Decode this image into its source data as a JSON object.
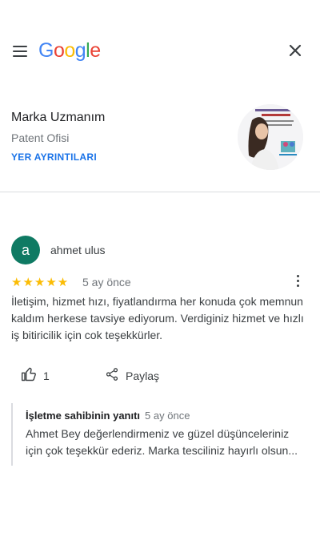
{
  "header": {
    "logo_letters": [
      "G",
      "o",
      "o",
      "g",
      "l",
      "e"
    ],
    "logo_colors": [
      "#4285F4",
      "#EA4335",
      "#FBBC05",
      "#4285F4",
      "#34A853",
      "#EA4335"
    ]
  },
  "business": {
    "name": "Marka Uzmanım",
    "category": "Patent Ofisi",
    "details_link": "YER AYRINTILARI"
  },
  "review": {
    "avatar_letter": "a",
    "author": "ahmet ulus",
    "stars": "★★★★★",
    "rating": 5,
    "time": "5 ay önce",
    "text": "İletişim, hizmet hızı, fiyatlandırma her konuda çok memnun kaldım herkese tavsiye ediyorum. Verdiginiz hizmet ve hızlı iş bitiricilik için cok teşekkürler.",
    "like_count": "1",
    "share_label": "Paylaş"
  },
  "reply": {
    "title": "İşletme sahibinin yanıtı",
    "time": "5 ay önce",
    "text": "Ahmet Bey değerlendirmeniz ve güzel düşünceleriniz için çok teşekkür ederiz. Marka tesciliniz hayırlı olsun..."
  },
  "icons": {
    "menu": "hamburger-menu-icon",
    "close": "close-icon",
    "like": "thumb-up-icon",
    "share": "share-icon",
    "more": "more-vert-icon"
  },
  "colors": {
    "link": "#1a73e8",
    "star": "#fbbc04",
    "avatar_bg": "#0f7a63"
  }
}
